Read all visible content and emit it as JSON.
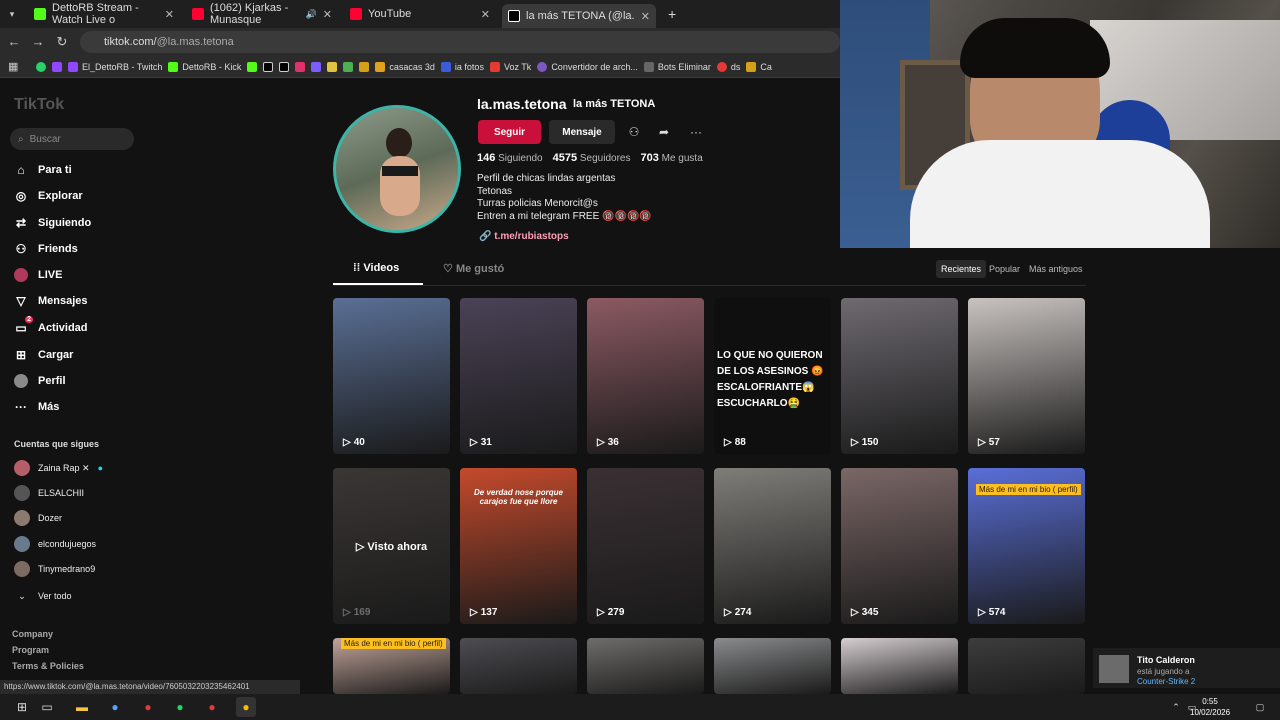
{
  "browser": {
    "tabs": [
      {
        "title": "DettoRB Stream - Watch Live o",
        "favicon_color": "#53fc18"
      },
      {
        "title": "(1062) Kjarkas - Munasque",
        "favicon_color": "#ff0033"
      },
      {
        "title": "YouTube",
        "favicon_color": "#ff0033"
      },
      {
        "title": "la más TETONA (@la.mas.teton",
        "favicon_color": "#ffffff"
      }
    ],
    "url_host": "tiktok.com/",
    "url_path": "@la.mas.tetona",
    "bookmarks": [
      "El_DettoRB - Twitch",
      "DettoRB - Kick",
      "casacas 3d",
      "ia fotos",
      "Voz Tk",
      "Convertidor de arch...",
      "Bots Eliminar",
      "ds",
      "Ca"
    ],
    "status_url": "https://www.tiktok.com/@la.mas.tetona/video/7605032203235462401"
  },
  "sidebar": {
    "logo": "TikTok",
    "search_placeholder": "Buscar",
    "nav": [
      {
        "label": "Para ti",
        "icon": "home-icon"
      },
      {
        "label": "Explorar",
        "icon": "compass-icon"
      },
      {
        "label": "Siguiendo",
        "icon": "following-icon"
      },
      {
        "label": "Friends",
        "icon": "friends-icon"
      },
      {
        "label": "LIVE",
        "icon": "live-icon"
      },
      {
        "label": "Mensajes",
        "icon": "messages-icon"
      },
      {
        "label": "Actividad",
        "icon": "activity-icon"
      },
      {
        "label": "Cargar",
        "icon": "upload-icon"
      },
      {
        "label": "Perfil",
        "icon": "profile-icon"
      },
      {
        "label": "Más",
        "icon": "more-icon"
      }
    ],
    "activity_badge": "2",
    "following_title": "Cuentas que sigues",
    "following": [
      "Zaina Rap ✕",
      "ELSALCHII",
      "Dozer",
      "elcondujuegos",
      "Tinymedrano9"
    ],
    "see_all": "Ver todo",
    "footer": [
      "Company",
      "Program",
      "Terms & Policies"
    ]
  },
  "profile": {
    "username": "la.mas.tetona",
    "nickname": "la más TETONA",
    "follow_label": "Seguir",
    "message_label": "Mensaje",
    "following_count": "146",
    "following_label": "Siguiendo",
    "followers_count": "4575",
    "followers_label": "Seguidores",
    "likes_count": "703",
    "likes_label": "Me gusta",
    "bio": [
      "Perfil de chicas lindas argentas",
      "Tetonas",
      "Turras policias Menorcit@s",
      "Entren a mi telegram FREE 🔞🔞🔞🔞"
    ],
    "link": "t.me/rubiastops"
  },
  "tabs": {
    "videos": "Videos",
    "liked": "Me gustó"
  },
  "sort": [
    "Recientes",
    "Popular",
    "Más antiguos"
  ],
  "videos": [
    {
      "views": "40",
      "color": "#5a6f95"
    },
    {
      "views": "31",
      "color": "#4a4256"
    },
    {
      "views": "36",
      "color": "#8c5a63"
    },
    {
      "views": "88",
      "color": "#1a1a1a",
      "caption_overlay": "LO QUE NO QUIERON DE LOS ASESINOS 😡 ESCALOFRIANTE😱 ESCUCHARLO🤮"
    },
    {
      "views": "150",
      "color": "#6e6a70"
    },
    {
      "views": "57",
      "color": "#c9c3c0"
    },
    {
      "views": "169",
      "color": "#3a3634",
      "seen": "Visto ahora"
    },
    {
      "views": "137",
      "color": "#c44a2c",
      "caption": "De verdad nose porque carajos fue que llore"
    },
    {
      "views": "279",
      "color": "#3a3033"
    },
    {
      "views": "274",
      "color": "#7f7d78"
    },
    {
      "views": "345",
      "color": "#7a6766"
    },
    {
      "views": "574",
      "color": "#5a6fd8",
      "tag": "Más de mi en mi bio ( perfil)"
    },
    {
      "views": "",
      "color": "#c2a49a",
      "tag": "Más de mi en mi bio ( perfil)"
    },
    {
      "views": "",
      "color": "#4d4d52"
    },
    {
      "views": "",
      "color": "#6f6d6a"
    },
    {
      "views": "",
      "color": "#8a8b8d"
    },
    {
      "views": "",
      "color": "#d6ced1"
    },
    {
      "views": "",
      "color": "#3d3d3d"
    }
  ],
  "notification": {
    "name": "Tito Calderon",
    "line2": "está jugando a",
    "game": "Counter-Strike 2"
  },
  "taskbar": {
    "time": "0:55",
    "date": "10/02/2026"
  }
}
